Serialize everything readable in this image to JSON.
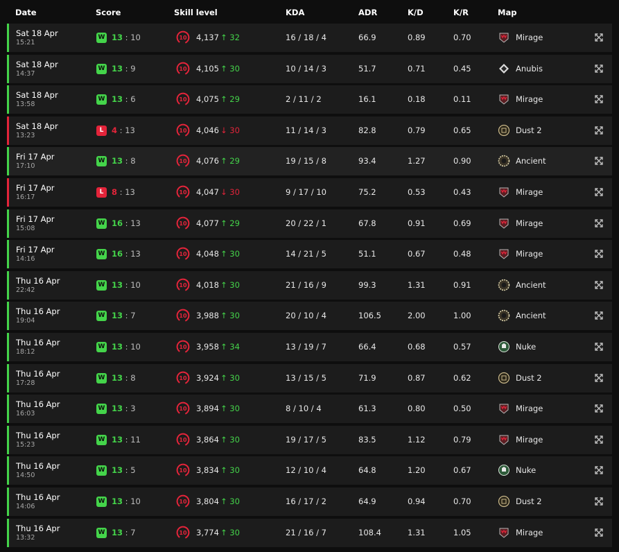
{
  "colors": {
    "win": "#44d44a",
    "loss": "#e3243a",
    "row_bg": "#1c1c1c",
    "page_bg": "#0e0e0e"
  },
  "columns": [
    "Date",
    "Score",
    "Skill level",
    "KDA",
    "ADR",
    "K/D",
    "K/R",
    "Map"
  ],
  "matches": [
    {
      "date": "Sat 18 Apr",
      "time": "15:21",
      "result": "W",
      "us": "13",
      "them": "10",
      "elo": "4,137",
      "dir": "up",
      "delta": "32",
      "kda": "16 / 18 / 4",
      "adr": "66.9",
      "kd": "0.89",
      "kr": "0.70",
      "map": "Mirage",
      "map_icon": "mirage-icon"
    },
    {
      "date": "Sat 18 Apr",
      "time": "14:37",
      "result": "W",
      "us": "13",
      "them": "9",
      "elo": "4,105",
      "dir": "up",
      "delta": "30",
      "kda": "10 / 14 / 3",
      "adr": "51.7",
      "kd": "0.71",
      "kr": "0.45",
      "map": "Anubis",
      "map_icon": "anubis-icon"
    },
    {
      "date": "Sat 18 Apr",
      "time": "13:58",
      "result": "W",
      "us": "13",
      "them": "6",
      "elo": "4,075",
      "dir": "up",
      "delta": "29",
      "kda": "2 / 11 / 2",
      "adr": "16.1",
      "kd": "0.18",
      "kr": "0.11",
      "map": "Mirage",
      "map_icon": "mirage-icon"
    },
    {
      "date": "Sat 18 Apr",
      "time": "13:23",
      "result": "L",
      "us": "4",
      "them": "13",
      "elo": "4,046",
      "dir": "down",
      "delta": "30",
      "kda": "11 / 14 / 3",
      "adr": "82.8",
      "kd": "0.79",
      "kr": "0.65",
      "map": "Dust 2",
      "map_icon": "dust2-icon"
    },
    {
      "date": "Fri 17 Apr",
      "time": "17:10",
      "result": "W",
      "us": "13",
      "them": "8",
      "elo": "4,076",
      "dir": "up",
      "delta": "29",
      "kda": "19 / 15 / 8",
      "adr": "93.4",
      "kd": "1.27",
      "kr": "0.90",
      "map": "Ancient",
      "map_icon": "ancient-icon"
    },
    {
      "date": "Fri 17 Apr",
      "time": "16:17",
      "result": "L",
      "us": "8",
      "them": "13",
      "elo": "4,047",
      "dir": "down",
      "delta": "30",
      "kda": "9 / 17 / 10",
      "adr": "75.2",
      "kd": "0.53",
      "kr": "0.43",
      "map": "Mirage",
      "map_icon": "mirage-icon"
    },
    {
      "date": "Fri 17 Apr",
      "time": "15:08",
      "result": "W",
      "us": "16",
      "them": "13",
      "elo": "4,077",
      "dir": "up",
      "delta": "29",
      "kda": "20 / 22 / 1",
      "adr": "67.8",
      "kd": "0.91",
      "kr": "0.69",
      "map": "Mirage",
      "map_icon": "mirage-icon"
    },
    {
      "date": "Fri 17 Apr",
      "time": "14:16",
      "result": "W",
      "us": "16",
      "them": "13",
      "elo": "4,048",
      "dir": "up",
      "delta": "30",
      "kda": "14 / 21 / 5",
      "adr": "51.1",
      "kd": "0.67",
      "kr": "0.48",
      "map": "Mirage",
      "map_icon": "mirage-icon"
    },
    {
      "date": "Thu 16 Apr",
      "time": "22:42",
      "result": "W",
      "us": "13",
      "them": "10",
      "elo": "4,018",
      "dir": "up",
      "delta": "30",
      "kda": "21 / 16 / 9",
      "adr": "99.3",
      "kd": "1.31",
      "kr": "0.91",
      "map": "Ancient",
      "map_icon": "ancient-icon"
    },
    {
      "date": "Thu 16 Apr",
      "time": "19:04",
      "result": "W",
      "us": "13",
      "them": "7",
      "elo": "3,988",
      "dir": "up",
      "delta": "30",
      "kda": "20 / 10 / 4",
      "adr": "106.5",
      "kd": "2.00",
      "kr": "1.00",
      "map": "Ancient",
      "map_icon": "ancient-icon"
    },
    {
      "date": "Thu 16 Apr",
      "time": "18:12",
      "result": "W",
      "us": "13",
      "them": "10",
      "elo": "3,958",
      "dir": "up",
      "delta": "34",
      "kda": "13 / 19 / 7",
      "adr": "66.4",
      "kd": "0.68",
      "kr": "0.57",
      "map": "Nuke",
      "map_icon": "nuke-icon"
    },
    {
      "date": "Thu 16 Apr",
      "time": "17:28",
      "result": "W",
      "us": "13",
      "them": "8",
      "elo": "3,924",
      "dir": "up",
      "delta": "30",
      "kda": "13 / 15 / 5",
      "adr": "71.9",
      "kd": "0.87",
      "kr": "0.62",
      "map": "Dust 2",
      "map_icon": "dust2-icon"
    },
    {
      "date": "Thu 16 Apr",
      "time": "16:03",
      "result": "W",
      "us": "13",
      "them": "3",
      "elo": "3,894",
      "dir": "up",
      "delta": "30",
      "kda": "8 / 10 / 4",
      "adr": "61.3",
      "kd": "0.80",
      "kr": "0.50",
      "map": "Mirage",
      "map_icon": "mirage-icon"
    },
    {
      "date": "Thu 16 Apr",
      "time": "15:23",
      "result": "W",
      "us": "13",
      "them": "11",
      "elo": "3,864",
      "dir": "up",
      "delta": "30",
      "kda": "19 / 17 / 5",
      "adr": "83.5",
      "kd": "1.12",
      "kr": "0.79",
      "map": "Mirage",
      "map_icon": "mirage-icon"
    },
    {
      "date": "Thu 16 Apr",
      "time": "14:50",
      "result": "W",
      "us": "13",
      "them": "5",
      "elo": "3,834",
      "dir": "up",
      "delta": "30",
      "kda": "12 / 10 / 4",
      "adr": "64.8",
      "kd": "1.20",
      "kr": "0.67",
      "map": "Nuke",
      "map_icon": "nuke-icon"
    },
    {
      "date": "Thu 16 Apr",
      "time": "14:06",
      "result": "W",
      "us": "13",
      "them": "10",
      "elo": "3,804",
      "dir": "up",
      "delta": "30",
      "kda": "16 / 17 / 2",
      "adr": "64.9",
      "kd": "0.94",
      "kr": "0.70",
      "map": "Dust 2",
      "map_icon": "dust2-icon"
    },
    {
      "date": "Thu 16 Apr",
      "time": "13:32",
      "result": "W",
      "us": "13",
      "them": "7",
      "elo": "3,774",
      "dir": "up",
      "delta": "30",
      "kda": "21 / 16 / 7",
      "adr": "108.4",
      "kd": "1.31",
      "kr": "1.05",
      "map": "Mirage",
      "map_icon": "mirage-icon"
    }
  ],
  "skill_level": "10",
  "icons": {
    "level": "skill-level-10-icon",
    "expand": "expand-icon",
    "up": "arrow-up-icon",
    "down": "arrow-down-icon"
  }
}
